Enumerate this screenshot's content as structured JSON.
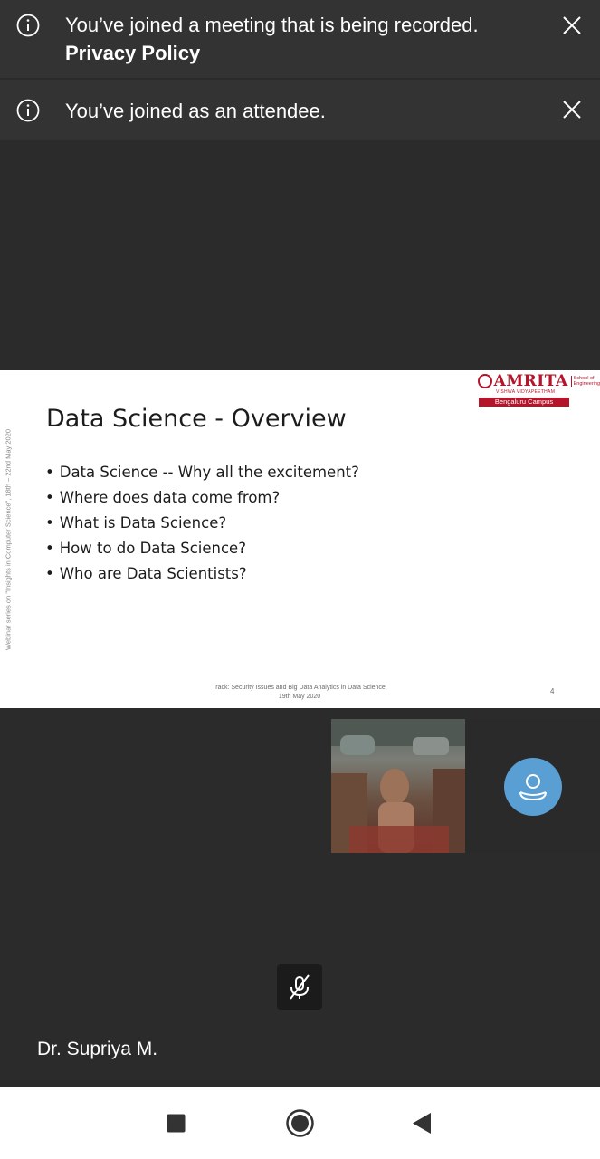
{
  "notifications": [
    {
      "message": "You’ve joined a meeting that is being recorded.",
      "link": "Privacy Policy"
    },
    {
      "message": "You’ve joined as an attendee."
    }
  ],
  "slide": {
    "title": "Data Science - Overview",
    "bullets": [
      "Data Science -- Why all the excitement?",
      "Where does data come from?",
      "What is Data Science?",
      "How to do Data Science?",
      "Who are Data Scientists?"
    ],
    "side_text": "Webinar series on \"Insights in Computer Science\", 18th – 22nd May 2020",
    "footer_line1": "Track: Security Issues and Big Data Analytics in Data Science,",
    "footer_line2": "19th May 2020",
    "page_number": "4",
    "logo": {
      "brand": "AMRITA",
      "sub": "VISHWA VIDYAPEETHAM",
      "school_line1": "School of",
      "school_line2": "Engineering",
      "campus": "Bengaluru Campus"
    }
  },
  "presenter": {
    "name": "Dr. Supriya M."
  },
  "icons": {
    "info": "info-icon",
    "close": "close-icon",
    "avatar": "person-icon",
    "mic": "mic-off-icon",
    "nav_recents": "square-icon",
    "nav_home": "circle-icon",
    "nav_back": "triangle-back-icon"
  },
  "colors": {
    "banner": "#333333",
    "background": "#2b2b2b",
    "avatar_button": "#5a9fd4",
    "brand_red": "#b5142b"
  }
}
